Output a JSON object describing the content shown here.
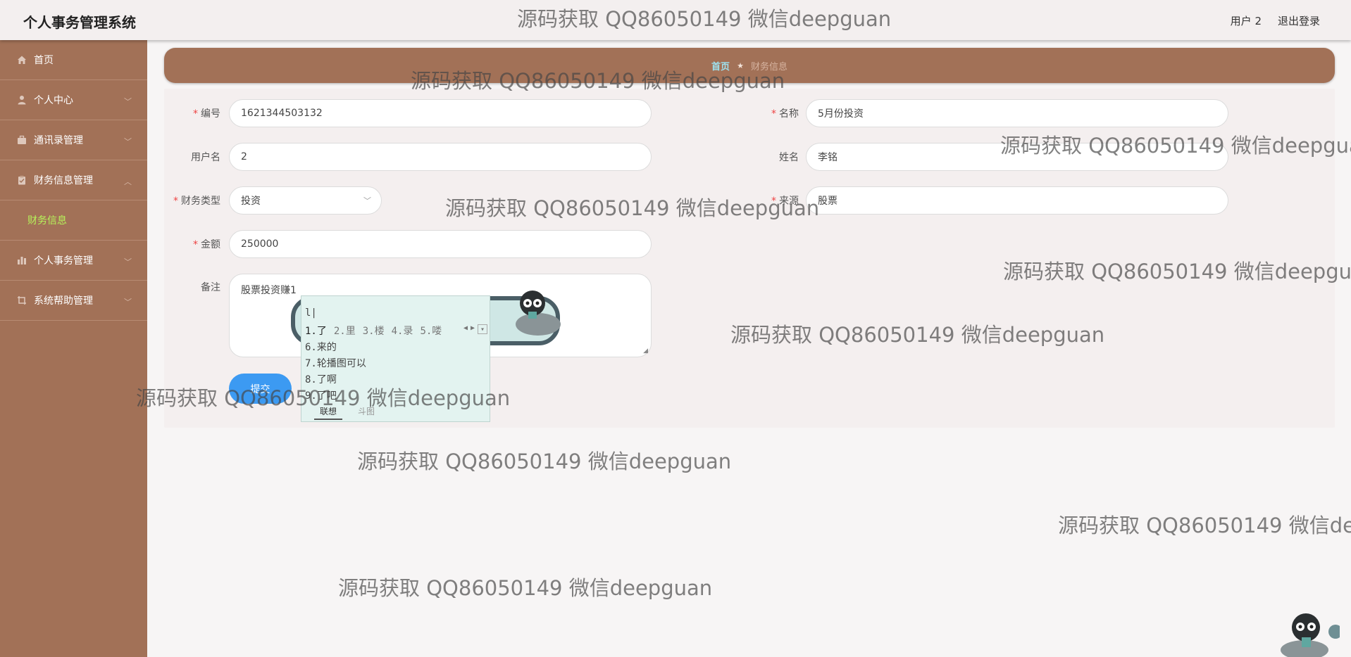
{
  "header": {
    "app_title": "个人事务管理系统",
    "user_label": "用户 2",
    "logout_label": "退出登录"
  },
  "sidebar": {
    "items": [
      {
        "label": "首页",
        "icon": "home-icon"
      },
      {
        "label": "个人中心",
        "icon": "user-icon"
      },
      {
        "label": "通讯录管理",
        "icon": "briefcase-icon"
      },
      {
        "label": "财务信息管理",
        "icon": "clipboard-icon"
      },
      {
        "label": "财务信息",
        "icon": ""
      },
      {
        "label": "个人事务管理",
        "icon": "bar-chart-icon"
      },
      {
        "label": "系统帮助管理",
        "icon": "crop-icon"
      }
    ]
  },
  "breadcrumb": {
    "home": "首页",
    "current": "财务信息"
  },
  "form": {
    "code_label": "编号",
    "code_value": "1621344503132",
    "name_label": "名称",
    "name_value": "5月份投资",
    "username_label": "用户名",
    "username_value": "2",
    "realname_label": "姓名",
    "realname_value": "李铭",
    "type_label": "财务类型",
    "type_value": "投资",
    "source_label": "来源",
    "source_value": "股票",
    "amount_label": "金额",
    "amount_value": "250000",
    "remark_label": "备注",
    "remark_value": "股票投资赚1",
    "submit_label": "提交"
  },
  "ime": {
    "pinyin": "l|",
    "row1": [
      "1.了",
      "2.里",
      "3.楼",
      "4.录",
      "5.喽"
    ],
    "more": [
      "6.来的",
      "7.轮播图可以",
      "8.了啊",
      "9.了吧"
    ],
    "tab_active": "联想",
    "tab_other": "斗图"
  },
  "watermark": "源码获取 QQ86050149 微信deepguan",
  "colors": {
    "sidebar_bg": "#a27157",
    "active_submenu": "#b6f35a",
    "submit_btn": "#3c9af2",
    "required": "#e44444"
  }
}
